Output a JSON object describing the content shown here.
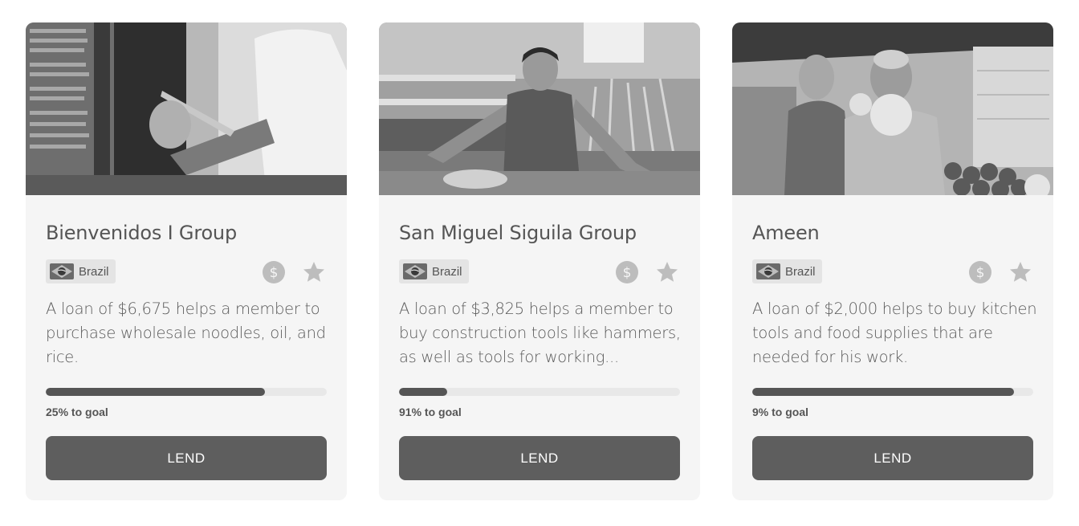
{
  "loans": [
    {
      "name": "Bienvenidos I Group",
      "country": "Brazil",
      "description": "A loan of $6,675 helps a member to purchase wholesale noodles, oil, and rice.",
      "goal_text": "25% to goal",
      "progress_fraction": 0.78,
      "lend_label": "LEND",
      "photo_icon": "market-vendor-photo"
    },
    {
      "name": "San Miguel Siguila Group",
      "country": "Brazil",
      "description": "A loan of $3,825 helps a member to buy construction tools like hammers, as well as tools for working...",
      "goal_text": "91% to goal",
      "progress_fraction": 0.17,
      "lend_label": "LEND",
      "photo_icon": "market-vendor-photo"
    },
    {
      "name": "Ameen",
      "country": "Brazil",
      "description": "A loan of $2,000 helps to buy kitchen tools and food supplies that are needed for his work.",
      "goal_text": "9% to goal",
      "progress_fraction": 0.93,
      "lend_label": "LEND",
      "photo_icon": "market-vendor-photo"
    }
  ],
  "colors": {
    "card_bg": "#f5f5f5",
    "button_bg": "#5e5e5e",
    "progress_fill": "#555555",
    "progress_track": "#e8e8e8",
    "icon_gray": "#bdbdbd"
  }
}
